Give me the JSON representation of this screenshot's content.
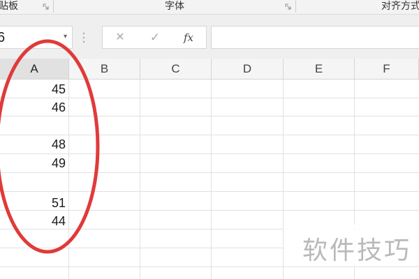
{
  "ribbon": {
    "groups": [
      "贴板",
      "字体",
      "对齐方式"
    ]
  },
  "formula_bar": {
    "name_box_value": "6",
    "cancel_icon": "✕",
    "enter_icon": "✓",
    "fx_label": "fx",
    "formula_value": ""
  },
  "grid": {
    "columns": [
      "A",
      "B",
      "C",
      "D",
      "E",
      "F"
    ],
    "selected_column": "A",
    "column_a_values": [
      "45",
      "46",
      "",
      "48",
      "49",
      "",
      "51",
      "44",
      "",
      ""
    ]
  },
  "annotation": {
    "ellipse_color": "#e03a3a"
  },
  "watermark": {
    "text": "软件技巧"
  }
}
